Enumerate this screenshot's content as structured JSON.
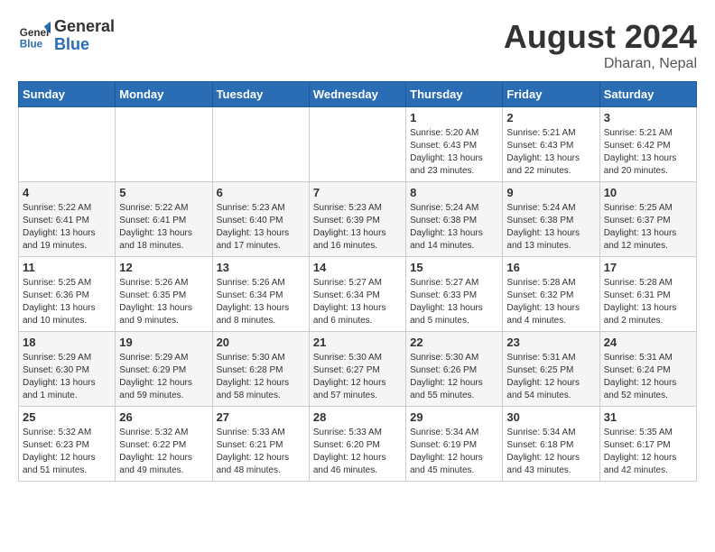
{
  "header": {
    "logo_line1": "General",
    "logo_line2": "Blue",
    "month_year": "August 2024",
    "location": "Dharan, Nepal"
  },
  "weekdays": [
    "Sunday",
    "Monday",
    "Tuesday",
    "Wednesday",
    "Thursday",
    "Friday",
    "Saturday"
  ],
  "weeks": [
    [
      {
        "day": "",
        "info": ""
      },
      {
        "day": "",
        "info": ""
      },
      {
        "day": "",
        "info": ""
      },
      {
        "day": "",
        "info": ""
      },
      {
        "day": "1",
        "info": "Sunrise: 5:20 AM\nSunset: 6:43 PM\nDaylight: 13 hours\nand 23 minutes."
      },
      {
        "day": "2",
        "info": "Sunrise: 5:21 AM\nSunset: 6:43 PM\nDaylight: 13 hours\nand 22 minutes."
      },
      {
        "day": "3",
        "info": "Sunrise: 5:21 AM\nSunset: 6:42 PM\nDaylight: 13 hours\nand 20 minutes."
      }
    ],
    [
      {
        "day": "4",
        "info": "Sunrise: 5:22 AM\nSunset: 6:41 PM\nDaylight: 13 hours\nand 19 minutes."
      },
      {
        "day": "5",
        "info": "Sunrise: 5:22 AM\nSunset: 6:41 PM\nDaylight: 13 hours\nand 18 minutes."
      },
      {
        "day": "6",
        "info": "Sunrise: 5:23 AM\nSunset: 6:40 PM\nDaylight: 13 hours\nand 17 minutes."
      },
      {
        "day": "7",
        "info": "Sunrise: 5:23 AM\nSunset: 6:39 PM\nDaylight: 13 hours\nand 16 minutes."
      },
      {
        "day": "8",
        "info": "Sunrise: 5:24 AM\nSunset: 6:38 PM\nDaylight: 13 hours\nand 14 minutes."
      },
      {
        "day": "9",
        "info": "Sunrise: 5:24 AM\nSunset: 6:38 PM\nDaylight: 13 hours\nand 13 minutes."
      },
      {
        "day": "10",
        "info": "Sunrise: 5:25 AM\nSunset: 6:37 PM\nDaylight: 13 hours\nand 12 minutes."
      }
    ],
    [
      {
        "day": "11",
        "info": "Sunrise: 5:25 AM\nSunset: 6:36 PM\nDaylight: 13 hours\nand 10 minutes."
      },
      {
        "day": "12",
        "info": "Sunrise: 5:26 AM\nSunset: 6:35 PM\nDaylight: 13 hours\nand 9 minutes."
      },
      {
        "day": "13",
        "info": "Sunrise: 5:26 AM\nSunset: 6:34 PM\nDaylight: 13 hours\nand 8 minutes."
      },
      {
        "day": "14",
        "info": "Sunrise: 5:27 AM\nSunset: 6:34 PM\nDaylight: 13 hours\nand 6 minutes."
      },
      {
        "day": "15",
        "info": "Sunrise: 5:27 AM\nSunset: 6:33 PM\nDaylight: 13 hours\nand 5 minutes."
      },
      {
        "day": "16",
        "info": "Sunrise: 5:28 AM\nSunset: 6:32 PM\nDaylight: 13 hours\nand 4 minutes."
      },
      {
        "day": "17",
        "info": "Sunrise: 5:28 AM\nSunset: 6:31 PM\nDaylight: 13 hours\nand 2 minutes."
      }
    ],
    [
      {
        "day": "18",
        "info": "Sunrise: 5:29 AM\nSunset: 6:30 PM\nDaylight: 13 hours\nand 1 minute."
      },
      {
        "day": "19",
        "info": "Sunrise: 5:29 AM\nSunset: 6:29 PM\nDaylight: 12 hours\nand 59 minutes."
      },
      {
        "day": "20",
        "info": "Sunrise: 5:30 AM\nSunset: 6:28 PM\nDaylight: 12 hours\nand 58 minutes."
      },
      {
        "day": "21",
        "info": "Sunrise: 5:30 AM\nSunset: 6:27 PM\nDaylight: 12 hours\nand 57 minutes."
      },
      {
        "day": "22",
        "info": "Sunrise: 5:30 AM\nSunset: 6:26 PM\nDaylight: 12 hours\nand 55 minutes."
      },
      {
        "day": "23",
        "info": "Sunrise: 5:31 AM\nSunset: 6:25 PM\nDaylight: 12 hours\nand 54 minutes."
      },
      {
        "day": "24",
        "info": "Sunrise: 5:31 AM\nSunset: 6:24 PM\nDaylight: 12 hours\nand 52 minutes."
      }
    ],
    [
      {
        "day": "25",
        "info": "Sunrise: 5:32 AM\nSunset: 6:23 PM\nDaylight: 12 hours\nand 51 minutes."
      },
      {
        "day": "26",
        "info": "Sunrise: 5:32 AM\nSunset: 6:22 PM\nDaylight: 12 hours\nand 49 minutes."
      },
      {
        "day": "27",
        "info": "Sunrise: 5:33 AM\nSunset: 6:21 PM\nDaylight: 12 hours\nand 48 minutes."
      },
      {
        "day": "28",
        "info": "Sunrise: 5:33 AM\nSunset: 6:20 PM\nDaylight: 12 hours\nand 46 minutes."
      },
      {
        "day": "29",
        "info": "Sunrise: 5:34 AM\nSunset: 6:19 PM\nDaylight: 12 hours\nand 45 minutes."
      },
      {
        "day": "30",
        "info": "Sunrise: 5:34 AM\nSunset: 6:18 PM\nDaylight: 12 hours\nand 43 minutes."
      },
      {
        "day": "31",
        "info": "Sunrise: 5:35 AM\nSunset: 6:17 PM\nDaylight: 12 hours\nand 42 minutes."
      }
    ]
  ]
}
